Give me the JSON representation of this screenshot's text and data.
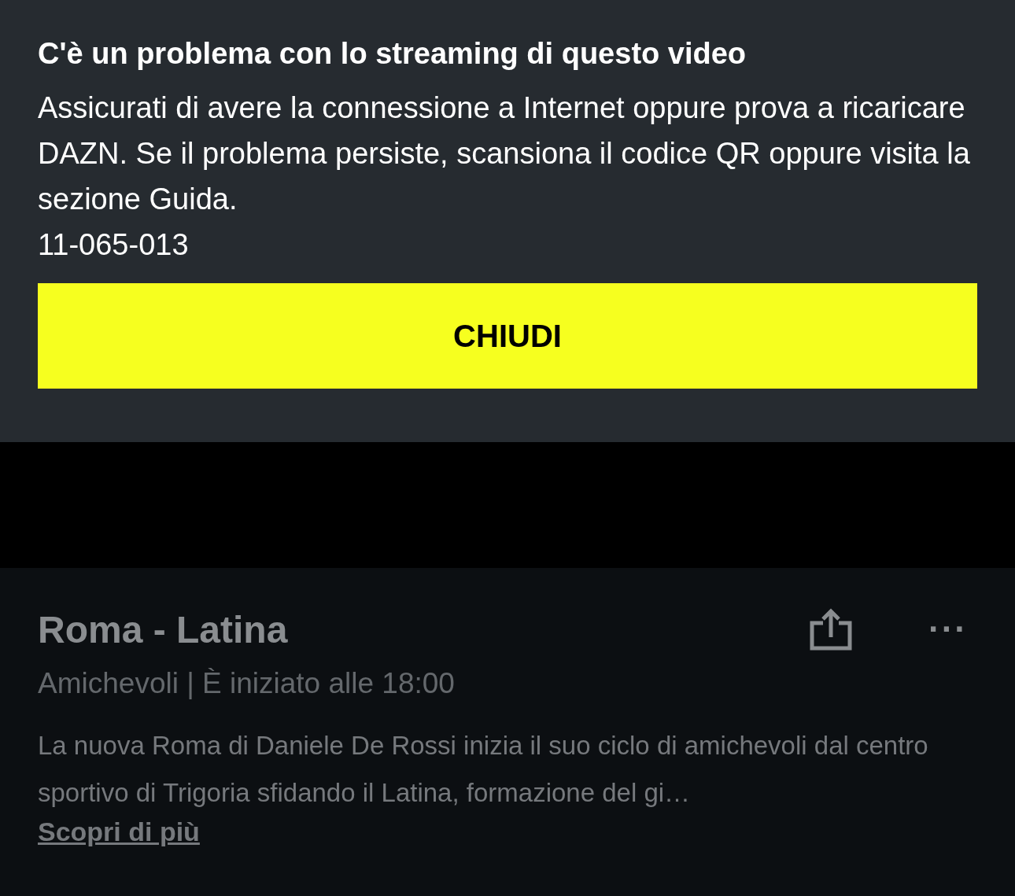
{
  "error_dialog": {
    "title": "C'è un problema con lo streaming di questo video",
    "message": "Assicurati di avere la connessione a Internet oppure prova a ricaricare DAZN. Se il problema persiste, scansiona il codice QR oppure visita la sezione Guida.",
    "error_code": "11-065-013",
    "button": "CHIUDI"
  },
  "event": {
    "title": "Roma - Latina",
    "meta": "Amichevoli | È iniziato alle 18:00",
    "description": "La nuova Roma di Daniele De Rossi inizia il suo ciclo di amichevoli dal centro sportivo di Trigoria sfidando il Latina, formazione del gi…",
    "link": "Scopri di più",
    "more_menu": "···"
  }
}
